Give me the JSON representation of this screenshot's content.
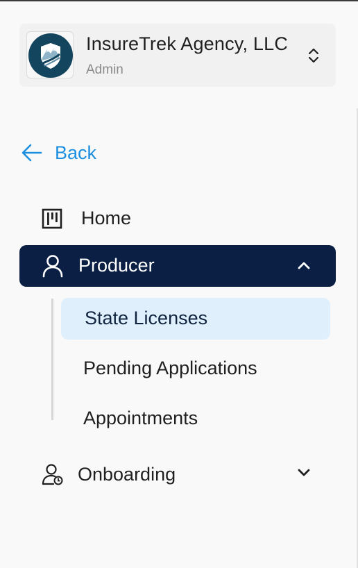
{
  "org": {
    "name": "InsureTrek Agency, LLC",
    "role": "Admin",
    "logo_icon": "insuretrek-mountain-logo"
  },
  "back": {
    "label": "Back",
    "icon": "arrow-left-icon"
  },
  "nav": {
    "home": {
      "label": "Home",
      "icon": "board-icon"
    },
    "producer": {
      "label": "Producer",
      "icon": "user-icon",
      "expanded": true,
      "children": [
        {
          "label": "State Licenses",
          "active": true
        },
        {
          "label": "Pending Applications",
          "active": false
        },
        {
          "label": "Appointments",
          "active": false
        }
      ]
    },
    "onboarding": {
      "label": "Onboarding",
      "icon": "user-clock-icon",
      "expanded": false
    }
  },
  "colors": {
    "accent": "#1d8fe0",
    "active_nav_bg": "#0b1f45",
    "active_sub_bg": "#dff0fc",
    "logo_bg": "#14455e"
  }
}
